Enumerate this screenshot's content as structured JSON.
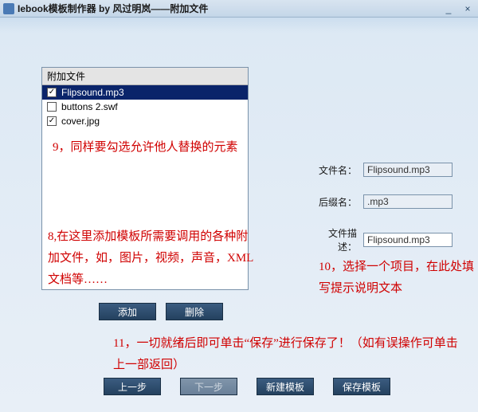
{
  "window": {
    "title": "Iebook模板制作器 by 风过明岚——附加文件"
  },
  "listbox": {
    "header": "附加文件",
    "items": [
      {
        "label": "Flipsound.mp3",
        "checked": true,
        "selected": true
      },
      {
        "label": "buttons 2.swf",
        "checked": false,
        "selected": false
      },
      {
        "label": "cover.jpg",
        "checked": true,
        "selected": false
      }
    ]
  },
  "fields": {
    "name_label": "文件名：",
    "name_value": "Flipsound.mp3",
    "ext_label": "后缀名：",
    "ext_value": ".mp3",
    "desc_label": "文件描述：",
    "desc_value": "Flipsound.mp3"
  },
  "buttons": {
    "add": "添加",
    "delete": "删除",
    "prev": "上一步",
    "next": "下一步",
    "new_template": "新建模板",
    "save_template": "保存模板"
  },
  "annotations": {
    "a9": "9，同样要勾选允许他人替换的元素",
    "a8": "8,在这里添加模板所需要调用的各种附加文件，如，图片，视频，声音，XML文档等……",
    "a10": "10，选择一个项目，在此处填写提示说明文本",
    "a11": "11，一切就绪后即可单击“保存”进行保存了！（如有误操作可单击上一部返回）"
  },
  "win_controls": {
    "min": "_",
    "close": "×"
  }
}
